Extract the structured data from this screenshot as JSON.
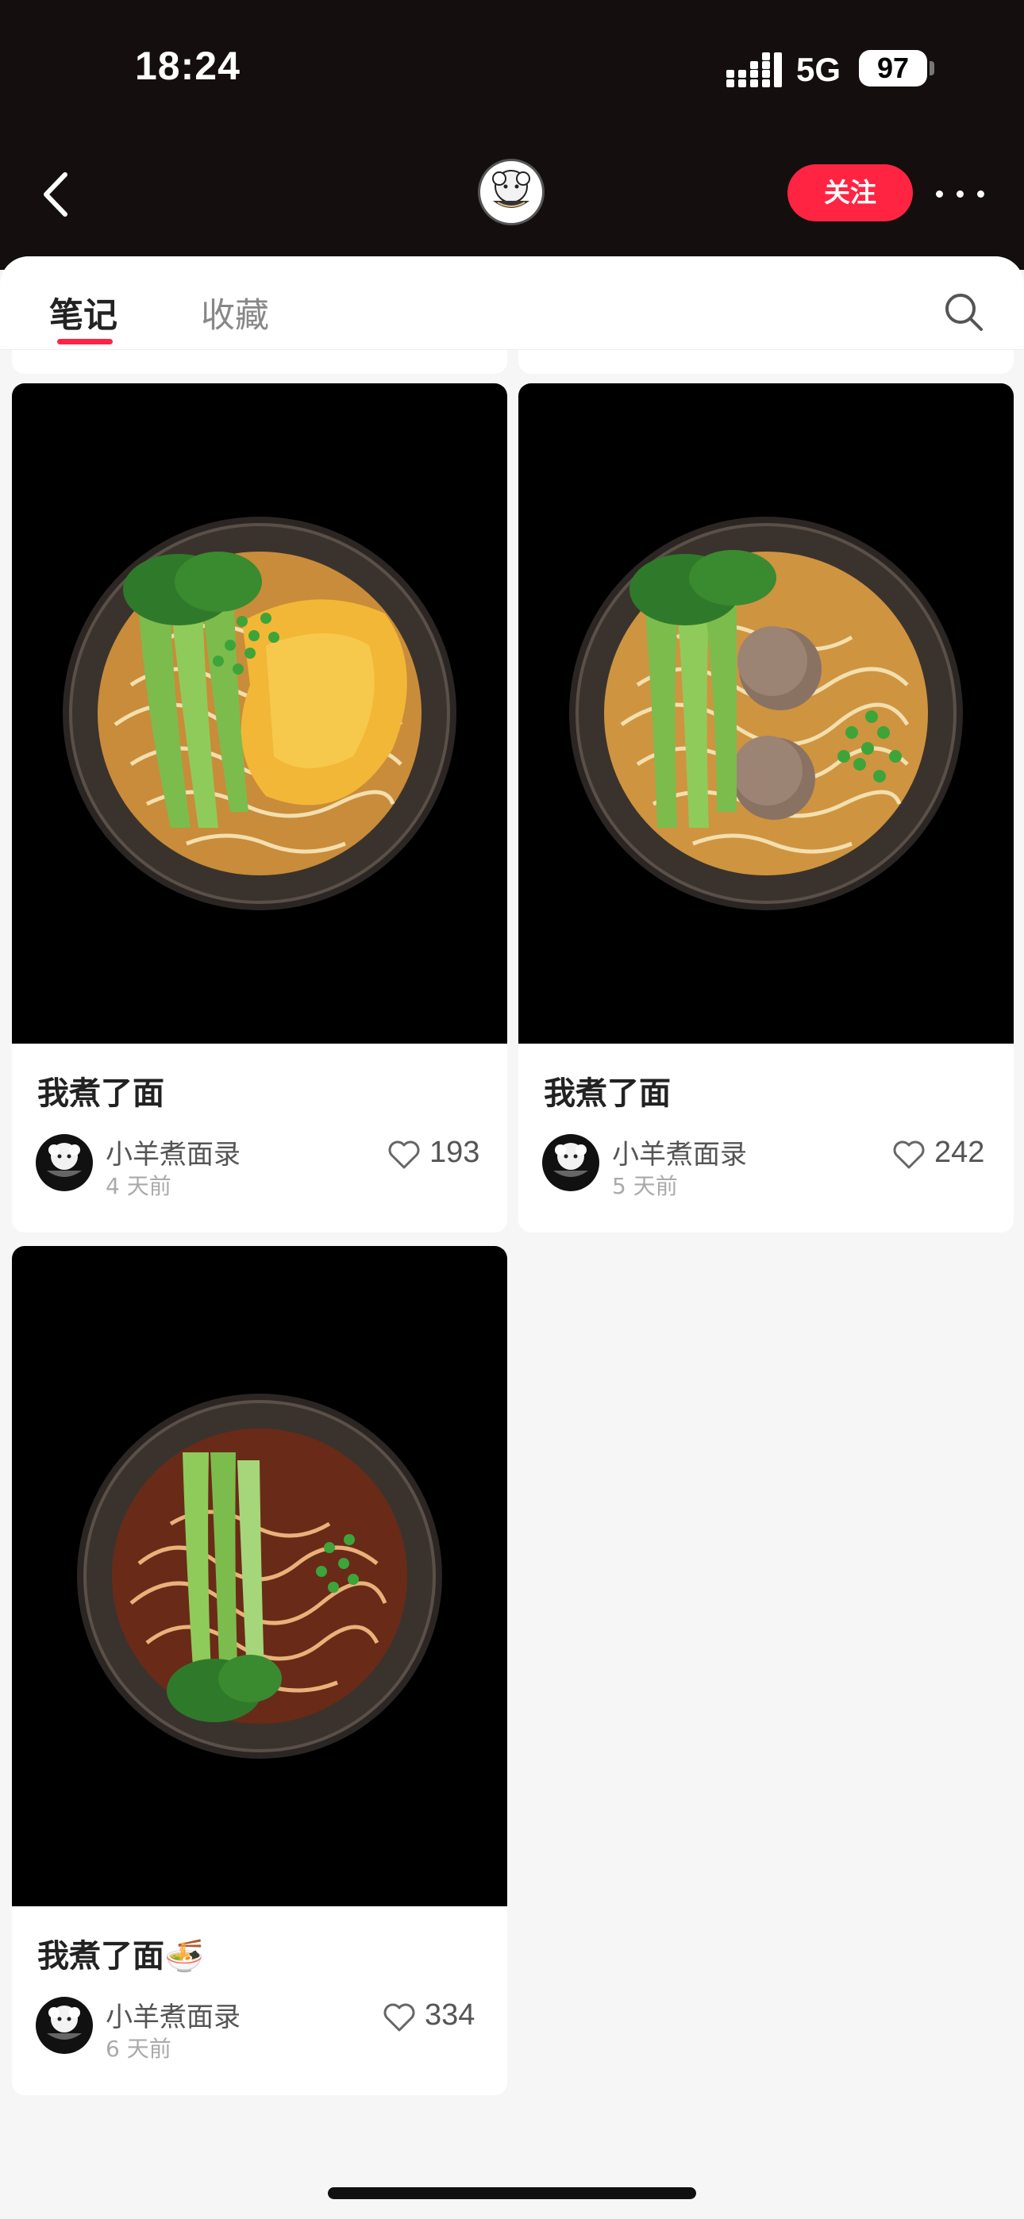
{
  "status_bar": {
    "time": "18:24",
    "network": "5G",
    "battery": "97"
  },
  "nav": {
    "back_icon": "chevron-left-icon",
    "avatar_icon": "sheep-noodle-avatar",
    "follow_label": "关注",
    "more_icon": "more-dots-icon"
  },
  "tabs": {
    "items": [
      {
        "label": "笔记",
        "active": true
      },
      {
        "label": "收藏",
        "active": false
      }
    ],
    "search_icon": "search-icon",
    "accent_color": "#ff2442"
  },
  "notes": [
    {
      "title": "我煮了面",
      "author": "小羊煮面录",
      "time": "4 天前",
      "likes": "193",
      "image": "noodle-bowl-fried-egg-bok-choy"
    },
    {
      "title": "我煮了面",
      "author": "小羊煮面录",
      "time": "5 天前",
      "likes": "242",
      "image": "noodle-bowl-meatballs-bok-choy"
    },
    {
      "title": "我煮了面",
      "title_emoji": "🍜",
      "author": "小羊煮面录",
      "time": "6 天前",
      "likes": "334",
      "image": "noodle-bowl-soy-broth-bok-choy"
    }
  ]
}
